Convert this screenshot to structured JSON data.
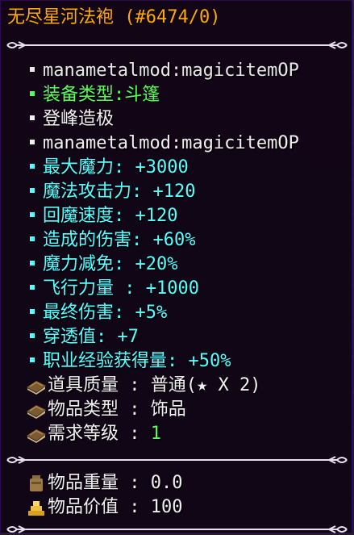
{
  "title": "无尽星河法袍 (#6474/0)",
  "lines": [
    {
      "text": "manametalmod:magicitemOP",
      "color": "#e8e8e8"
    },
    {
      "text": "装备类型:斗篷",
      "color": "#55ff55"
    },
    {
      "text": "登峰造极",
      "color": "#f0f0f0"
    },
    {
      "text": "manametalmod:magicitemOP",
      "color": "#f0f0f0"
    },
    {
      "text": "最大魔力: +3000",
      "color": "#55ffff"
    },
    {
      "text": "魔法攻击力: +120",
      "color": "#55ffff"
    },
    {
      "text": "回魔速度: +120",
      "color": "#55ffff"
    },
    {
      "text": "造成的伤害: +60%",
      "color": "#55ffff"
    },
    {
      "text": "魔力减免: +20%",
      "color": "#55ffff"
    },
    {
      "text": "飞行力量 : +1000",
      "color": "#55ffff"
    },
    {
      "text": "最终伤害: +5%",
      "color": "#55ffff"
    },
    {
      "text": "穿透值: +7",
      "color": "#55ffff"
    },
    {
      "text": "职业经验获得量: +50%",
      "color": "#55ffff"
    }
  ],
  "properties": [
    {
      "label": "道具质量",
      "sep": " : ",
      "value": "普通(★ X 2)",
      "value_color": "#f0f0f0",
      "icon": "book-icon"
    },
    {
      "label": "物品类型",
      "sep": " : ",
      "value": "饰品",
      "value_color": "#f0f0f0",
      "icon": "book-icon"
    },
    {
      "label": "需求等级",
      "sep": " : ",
      "value": "1",
      "value_color": "#55ff55",
      "icon": "book-icon"
    }
  ],
  "stats": [
    {
      "label": "物品重量",
      "sep": " : ",
      "value": "0.0",
      "icon": "bag-icon"
    },
    {
      "label": "物品价值",
      "sep": " : ",
      "value": "100",
      "icon": "gold-icon"
    }
  ],
  "colors": {
    "title": "#ffaa00",
    "background": "#100414",
    "border": "#2a0a52",
    "separator": "#e8e0f0"
  }
}
